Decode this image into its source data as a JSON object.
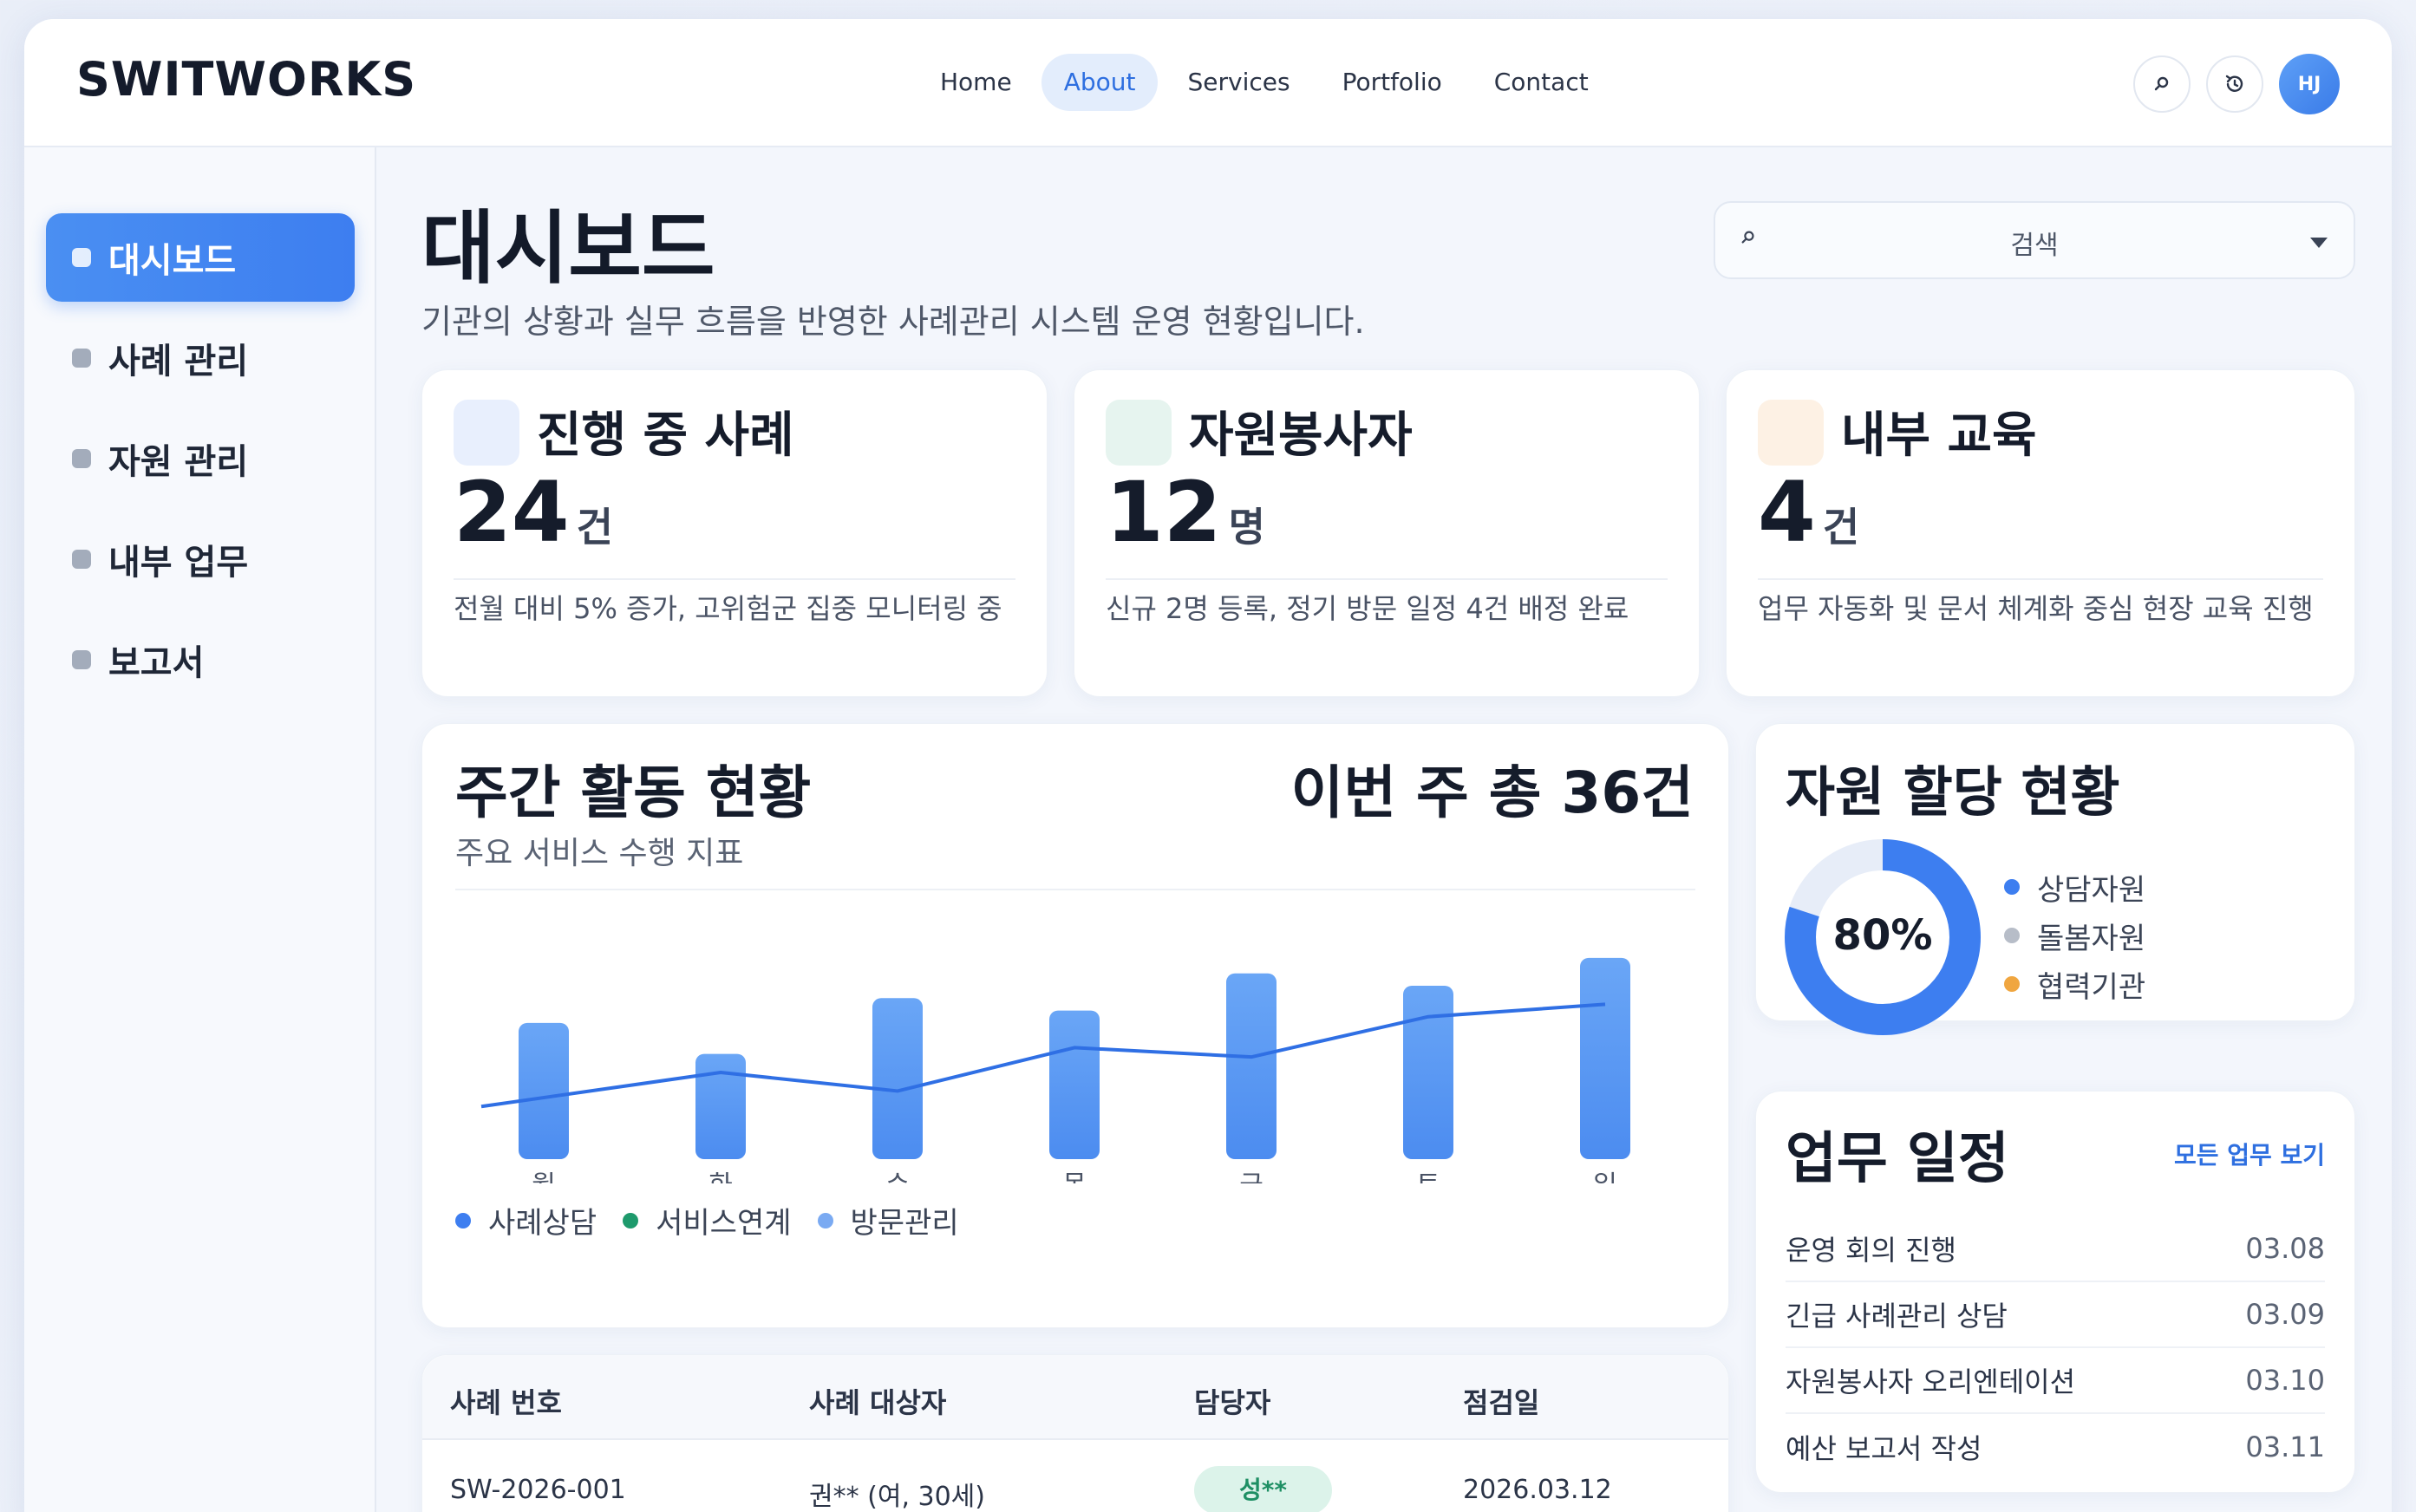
{
  "header": {
    "brand": "SWITWORKS",
    "nav": [
      "Home",
      "About",
      "Services",
      "Portfolio",
      "Contact"
    ],
    "active_nav": "About",
    "avatar_initials": "HJ",
    "icons": [
      "search-icon",
      "history-icon"
    ]
  },
  "sidebar": {
    "items": [
      {
        "label": "대시보드",
        "active": true
      },
      {
        "label": "사례 관리",
        "active": false
      },
      {
        "label": "자원 관리",
        "active": false
      },
      {
        "label": "내부 업무",
        "active": false
      },
      {
        "label": "보고서",
        "active": false
      }
    ]
  },
  "page": {
    "title": "대시보드",
    "subtitle": "기관의 상황과 실무 흐름을 반영한 사례관리 시스템 운영 현황입니다.",
    "search_placeholder": "검색"
  },
  "stats": [
    {
      "title": "진행 중 사례",
      "value": "24",
      "unit": "건",
      "desc": "전월 대비 5% 증가, 고위험군 집중 모니터링 중",
      "color": "#e8effd"
    },
    {
      "title": "자원봉사자",
      "value": "12",
      "unit": "명",
      "desc": "신규 2명 등록, 정기 방문 일정 4건 배정 완료",
      "color": "#e6f4ef"
    },
    {
      "title": "내부 교육",
      "value": "4",
      "unit": "건",
      "desc": "업무 자동화 및 문서 체계화 중심 현장 교육 진행",
      "color": "#fdf1e4"
    }
  ],
  "weekly": {
    "title": "주간 활동 현황",
    "total": "이번 주 총 36건",
    "subtitle": "주요 서비스 수행 지표",
    "legend": [
      {
        "name": "사례상담",
        "color": "#3d7ef0"
      },
      {
        "name": "서비스연계",
        "color": "#1e9a6c"
      },
      {
        "name": "방문관리",
        "color": "#7aaaf2"
      }
    ]
  },
  "chart_data": {
    "type": "bar",
    "categories": [
      "월",
      "화",
      "수",
      "목",
      "금",
      "토",
      "일"
    ],
    "series": [
      {
        "kind": "bar",
        "values": [
          44,
          34,
          52,
          48,
          60,
          56,
          65
        ]
      },
      {
        "kind": "line",
        "values": [
          17,
          28,
          22,
          36,
          33,
          46,
          50
        ]
      }
    ],
    "ylim": [
      0,
      70
    ],
    "grid": false
  },
  "alloc": {
    "title": "자원 할당 현황",
    "percent_label": "80%",
    "percent_value": 80,
    "legend": [
      {
        "name": "상담자원",
        "color": "#3d7ef0"
      },
      {
        "name": "돌봄자원",
        "color": "#b7bdc8"
      },
      {
        "name": "협력기관",
        "color": "#f0a640"
      }
    ]
  },
  "schedule": {
    "title": "업무 일정",
    "link": "모든 업무 보기",
    "rows": [
      {
        "task": "운영 회의 진행",
        "date": "03.08"
      },
      {
        "task": "긴급 사례관리 상담",
        "date": "03.09"
      },
      {
        "task": "자원봉사자 오리엔테이션",
        "date": "03.10"
      },
      {
        "task": "예산 보고서 작성",
        "date": "03.11"
      }
    ]
  },
  "table": {
    "headers": [
      "사례 번호",
      "사례 대상자",
      "담당자",
      "점검일"
    ],
    "rows": [
      [
        "SW-2026-001",
        "권** (여, 30세)",
        "성**",
        "2026.03.12"
      ]
    ]
  }
}
